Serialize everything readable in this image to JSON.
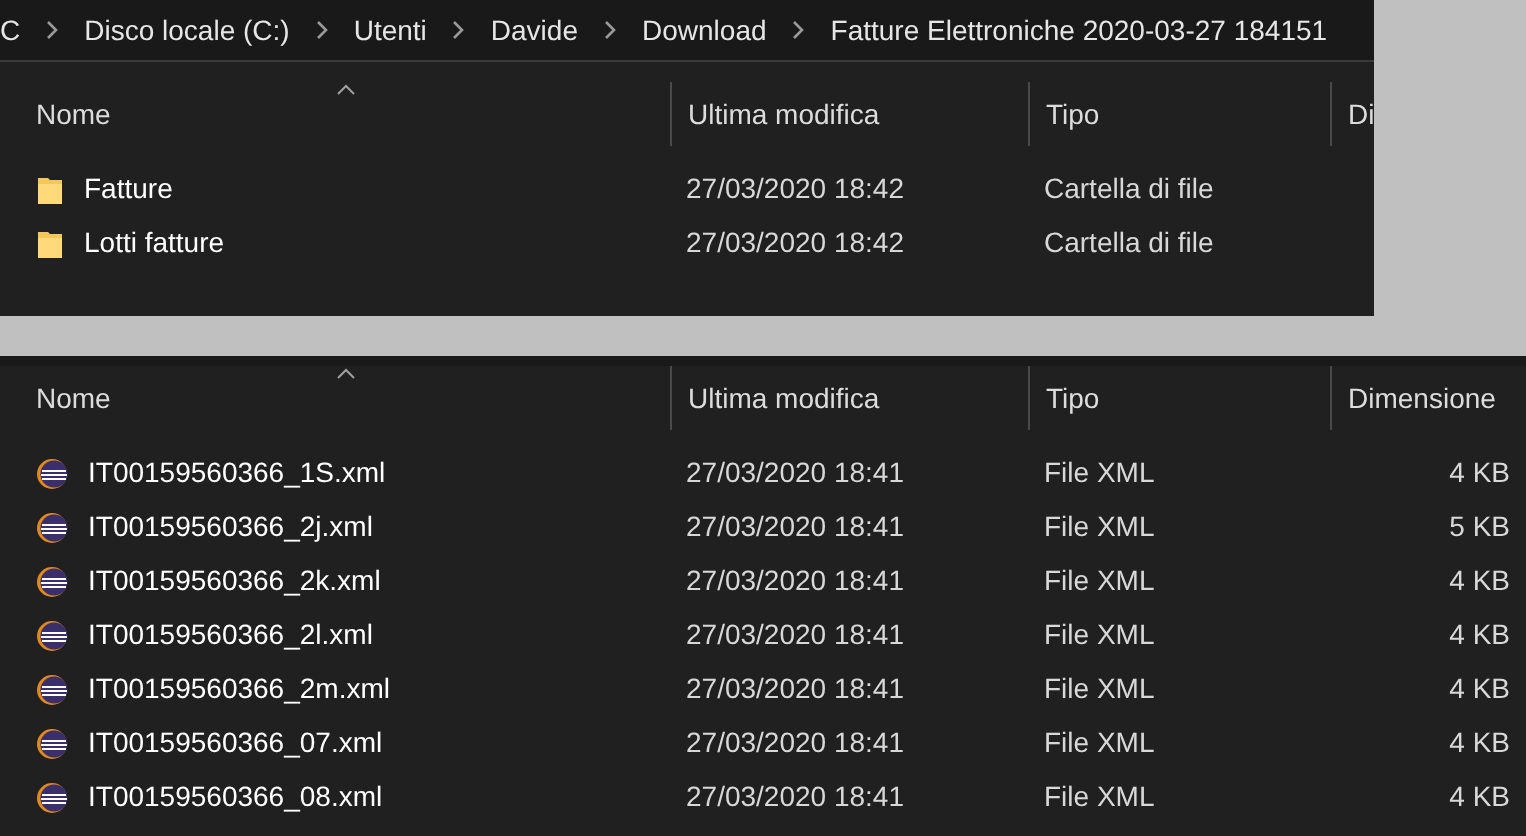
{
  "breadcrumb": [
    "C",
    "Disco locale (C:)",
    "Utenti",
    "Davide",
    "Download",
    "Fatture Elettroniche 2020-03-27 184151"
  ],
  "top_pane": {
    "columns": [
      {
        "label": "Nome",
        "sorted": true
      },
      {
        "label": "Ultima modifica",
        "sorted": false
      },
      {
        "label": "Tipo",
        "sorted": false
      },
      {
        "label": "Di",
        "sorted": false
      }
    ],
    "rows": [
      {
        "kind": "folder",
        "name": "Fatture",
        "modified": "27/03/2020 18:42",
        "type": "Cartella di file"
      },
      {
        "kind": "folder",
        "name": "Lotti fatture",
        "modified": "27/03/2020 18:42",
        "type": "Cartella di file"
      }
    ]
  },
  "bottom_pane": {
    "columns": [
      {
        "label": "Nome",
        "sorted": true
      },
      {
        "label": "Ultima modifica",
        "sorted": false
      },
      {
        "label": "Tipo",
        "sorted": false
      },
      {
        "label": "Dimensione",
        "sorted": false
      }
    ],
    "rows": [
      {
        "kind": "xml",
        "name": "IT00159560366_1S.xml",
        "modified": "27/03/2020 18:41",
        "type": "File XML",
        "size": "4 KB"
      },
      {
        "kind": "xml",
        "name": "IT00159560366_2j.xml",
        "modified": "27/03/2020 18:41",
        "type": "File XML",
        "size": "5 KB"
      },
      {
        "kind": "xml",
        "name": "IT00159560366_2k.xml",
        "modified": "27/03/2020 18:41",
        "type": "File XML",
        "size": "4 KB"
      },
      {
        "kind": "xml",
        "name": "IT00159560366_2l.xml",
        "modified": "27/03/2020 18:41",
        "type": "File XML",
        "size": "4 KB"
      },
      {
        "kind": "xml",
        "name": "IT00159560366_2m.xml",
        "modified": "27/03/2020 18:41",
        "type": "File XML",
        "size": "4 KB"
      },
      {
        "kind": "xml",
        "name": "IT00159560366_07.xml",
        "modified": "27/03/2020 18:41",
        "type": "File XML",
        "size": "4 KB"
      },
      {
        "kind": "xml",
        "name": "IT00159560366_08.xml",
        "modified": "27/03/2020 18:41",
        "type": "File XML",
        "size": "4 KB"
      }
    ]
  }
}
